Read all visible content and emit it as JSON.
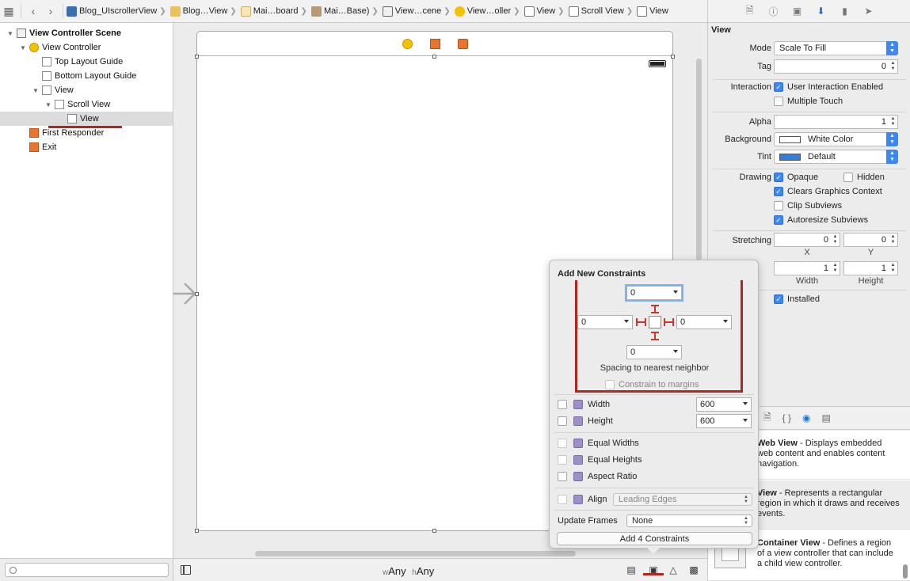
{
  "jumpbar": {
    "crumbs": [
      {
        "label": "Blog_UIscrollerView",
        "icon": "project-icon"
      },
      {
        "label": "Blog…View",
        "icon": "folder-icon"
      },
      {
        "label": "Mai…board",
        "icon": "storyboard-file-icon"
      },
      {
        "label": "Mai…Base)",
        "icon": "storyboard-base-icon"
      },
      {
        "label": "View…cene",
        "icon": "scene-icon"
      },
      {
        "label": "View…oller",
        "icon": "view-controller-icon"
      },
      {
        "label": "View",
        "icon": "view-icon"
      },
      {
        "label": "Scroll View",
        "icon": "scroll-view-icon"
      },
      {
        "label": "View",
        "icon": "view-icon"
      }
    ]
  },
  "outline": {
    "scene": "View Controller Scene",
    "controller": "View Controller",
    "top_guide": "Top Layout Guide",
    "bottom_guide": "Bottom Layout Guide",
    "view": "View",
    "scroll_view": "Scroll View",
    "content_view": "View",
    "first_responder": "First Responder",
    "exit": "Exit"
  },
  "canvas": {
    "size_w_prefix": "w",
    "size_w": "Any",
    "size_h_prefix": "h",
    "size_h": "Any"
  },
  "inspector": {
    "section": "View",
    "mode_label": "Mode",
    "mode_value": "Scale To Fill",
    "tag_label": "Tag",
    "tag_value": "0",
    "interaction_label": "Interaction",
    "user_interaction": "User Interaction Enabled",
    "multiple_touch": "Multiple Touch",
    "alpha_label": "Alpha",
    "alpha_value": "1",
    "background_label": "Background",
    "background_value": "White Color",
    "tint_label": "Tint",
    "tint_value": "Default",
    "drawing_label": "Drawing",
    "opaque": "Opaque",
    "hidden": "Hidden",
    "clears_context": "Clears Graphics Context",
    "clip_subviews": "Clip Subviews",
    "autoresize_subviews": "Autoresize Subviews",
    "stretching_label": "Stretching",
    "stretch_x": "0",
    "stretch_y": "0",
    "x_label": "X",
    "y_label": "Y",
    "stretch_w": "1",
    "stretch_h": "1",
    "width_label": "Width",
    "height_label": "Height",
    "installed": "Installed",
    "colors": {
      "tint": "#2f7fe0",
      "background": "#ffffff",
      "accent": "#3b88f5"
    }
  },
  "library": {
    "items": [
      {
        "title": "Web View",
        "desc": " - Displays embedded web content and enables content navigation."
      },
      {
        "title": "View",
        "desc": " - Represents a rectangular region in which it draws and receives events."
      },
      {
        "title": "Container View",
        "desc": " - Defines a region of a view controller that can include a child view controller."
      }
    ]
  },
  "popover": {
    "title": "Add New Constraints",
    "top": "0",
    "left": "0",
    "right": "0",
    "bottom": "0",
    "spacing_label": "Spacing to nearest neighbor",
    "constrain_margins": "Constrain to margins",
    "width_label": "Width",
    "width_value": "600",
    "height_label": "Height",
    "height_value": "600",
    "equal_widths": "Equal Widths",
    "equal_heights": "Equal Heights",
    "aspect_ratio": "Aspect Ratio",
    "align_label": "Align",
    "align_value": "Leading Edges",
    "update_frames_label": "Update Frames",
    "update_frames_value": "None",
    "add_button": "Add 4 Constraints",
    "colors": {
      "pin": "#b2261d"
    }
  }
}
